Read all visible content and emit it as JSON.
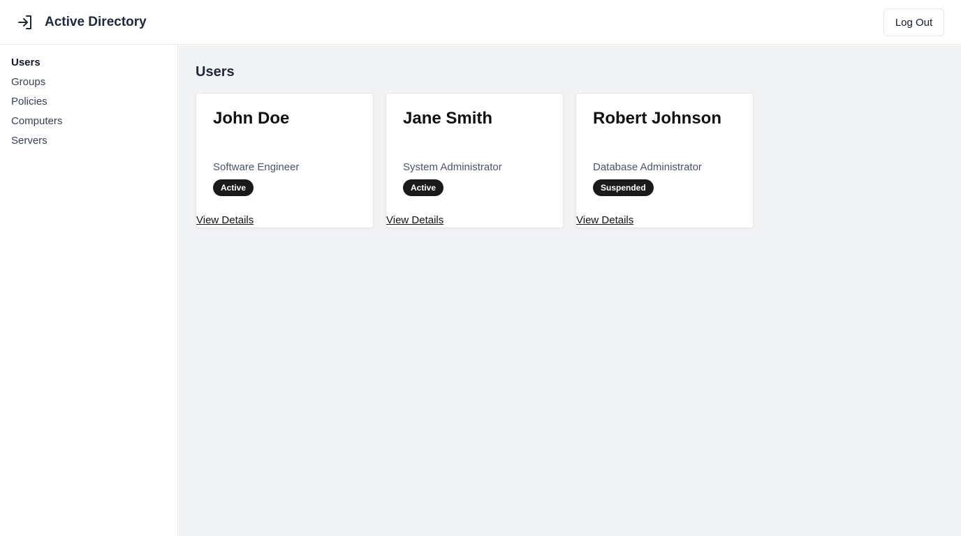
{
  "header": {
    "logo_icon": "login-arrow-icon",
    "title": "Active Directory",
    "logout_label": "Log Out"
  },
  "sidebar": {
    "items": [
      {
        "label": "Users",
        "active": true
      },
      {
        "label": "Groups",
        "active": false
      },
      {
        "label": "Policies",
        "active": false
      },
      {
        "label": "Computers",
        "active": false
      },
      {
        "label": "Servers",
        "active": false
      }
    ]
  },
  "main": {
    "title": "Users",
    "users": [
      {
        "name": "John Doe",
        "role": "Software Engineer",
        "status": "Active",
        "link": "View Details"
      },
      {
        "name": "Jane Smith",
        "role": "System Administrator",
        "status": "Active",
        "link": "View Details"
      },
      {
        "name": "Robert Johnson",
        "role": "Database Administrator",
        "status": "Suspended",
        "link": "View Details"
      }
    ]
  },
  "colors": {
    "badge_bg": "#1a1a1a",
    "main_bg": "#f2f3f5",
    "border": "#e5e7eb"
  }
}
